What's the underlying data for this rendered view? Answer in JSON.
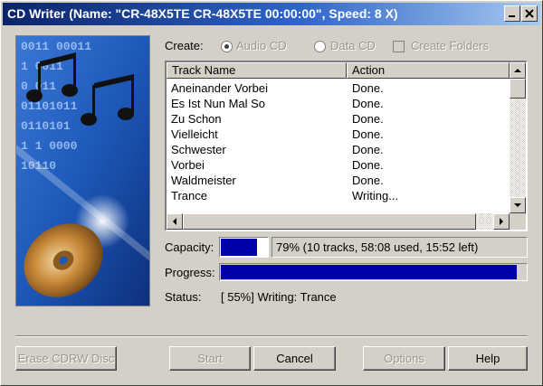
{
  "window": {
    "title": "CD Writer (Name: \"CR-48X5TE CR-48X5TE 00:00:00\", Speed: 8 X)"
  },
  "artwork": {
    "binary_lines": [
      "0011 00011",
      "1  0011",
      "0   011",
      "01101011",
      "0110101",
      "1  1  0000",
      "10110"
    ]
  },
  "create": {
    "label": "Create:",
    "audio_cd": "Audio CD",
    "data_cd": "Data CD",
    "create_folders": "Create Folders",
    "selected": "Audio CD"
  },
  "track_list": {
    "columns": [
      "Track Name",
      "Action"
    ],
    "rows": [
      {
        "name": "Aneinander Vorbei",
        "action": "Done."
      },
      {
        "name": "Es Ist Nun Mal So",
        "action": "Done."
      },
      {
        "name": "Zu Schon",
        "action": "Done."
      },
      {
        "name": "Vielleicht",
        "action": "Done."
      },
      {
        "name": "Schwester",
        "action": "Done."
      },
      {
        "name": "Vorbei",
        "action": "Done."
      },
      {
        "name": "Waldmeister",
        "action": "Done."
      },
      {
        "name": "Trance",
        "action": "Writing..."
      }
    ]
  },
  "capacity": {
    "label": "Capacity:",
    "text": "79% (10 tracks, 58:08 used, 15:52 left)",
    "fraction": 0.79
  },
  "progress": {
    "label": "Progress:",
    "fraction": 0.97
  },
  "status": {
    "label": "Status:",
    "text": "[ 55%] Writing: Trance"
  },
  "buttons": {
    "erase": "Erase CDRW Disc",
    "start": "Start",
    "cancel": "Cancel",
    "options": "Options",
    "help": "Help"
  },
  "colors": {
    "bar_fill": "#0000a8",
    "title_start": "#0a246a",
    "title_end": "#a6caf0"
  }
}
